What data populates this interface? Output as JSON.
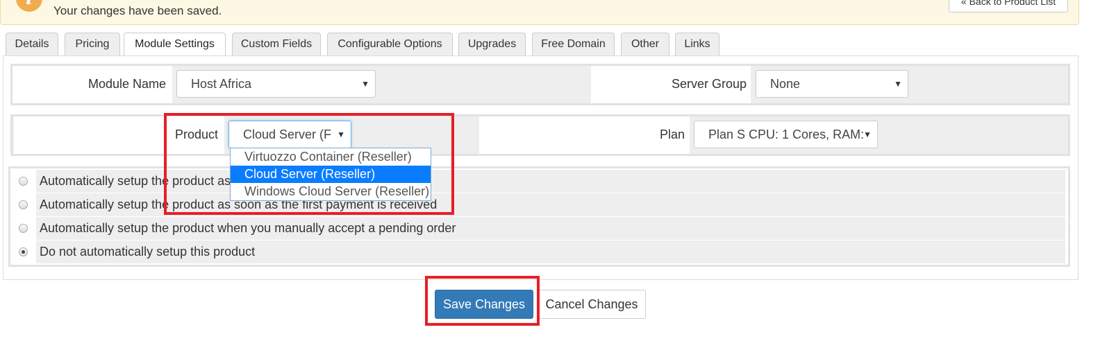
{
  "alert": {
    "message": "Your changes have been saved.",
    "icon": "info-icon",
    "back_label": "« Back to Product List"
  },
  "tabs": [
    {
      "label": "Details"
    },
    {
      "label": "Pricing"
    },
    {
      "label": "Module Settings"
    },
    {
      "label": "Custom Fields"
    },
    {
      "label": "Configurable Options"
    },
    {
      "label": "Upgrades"
    },
    {
      "label": "Free Domain"
    },
    {
      "label": "Other"
    },
    {
      "label": "Links"
    }
  ],
  "active_tab": "Module Settings",
  "module": {
    "module_name_label": "Module Name",
    "module_name_value": "Host Africa",
    "server_group_label": "Server Group",
    "server_group_value": "None",
    "product_label": "Product",
    "product_value": "Cloud Server (F",
    "plan_label": "Plan",
    "plan_value": "Plan S CPU: 1 Cores, RAM:"
  },
  "product_options": [
    {
      "label": "Virtuozzo Container (Reseller)"
    },
    {
      "label": "Cloud Server (Reseller)"
    },
    {
      "label": "Windows Cloud Server (Reseller)"
    }
  ],
  "product_selected": "Cloud Server (Reseller)",
  "setup_options": [
    {
      "label": "Automatically setup the product as soon as an order is placed",
      "checked": false
    },
    {
      "label": "Automatically setup the product as soon as the first payment is received",
      "checked": false
    },
    {
      "label": "Automatically setup the product when you manually accept a pending order",
      "checked": false
    },
    {
      "label": "Do not automatically setup this product",
      "checked": true
    }
  ],
  "buttons": {
    "save": "Save Changes",
    "cancel": "Cancel Changes"
  },
  "colors": {
    "primary": "#337ab7",
    "highlight": "#e81e26",
    "selected_option": "#0a7cff",
    "alert_bg": "#fcf8e3"
  }
}
